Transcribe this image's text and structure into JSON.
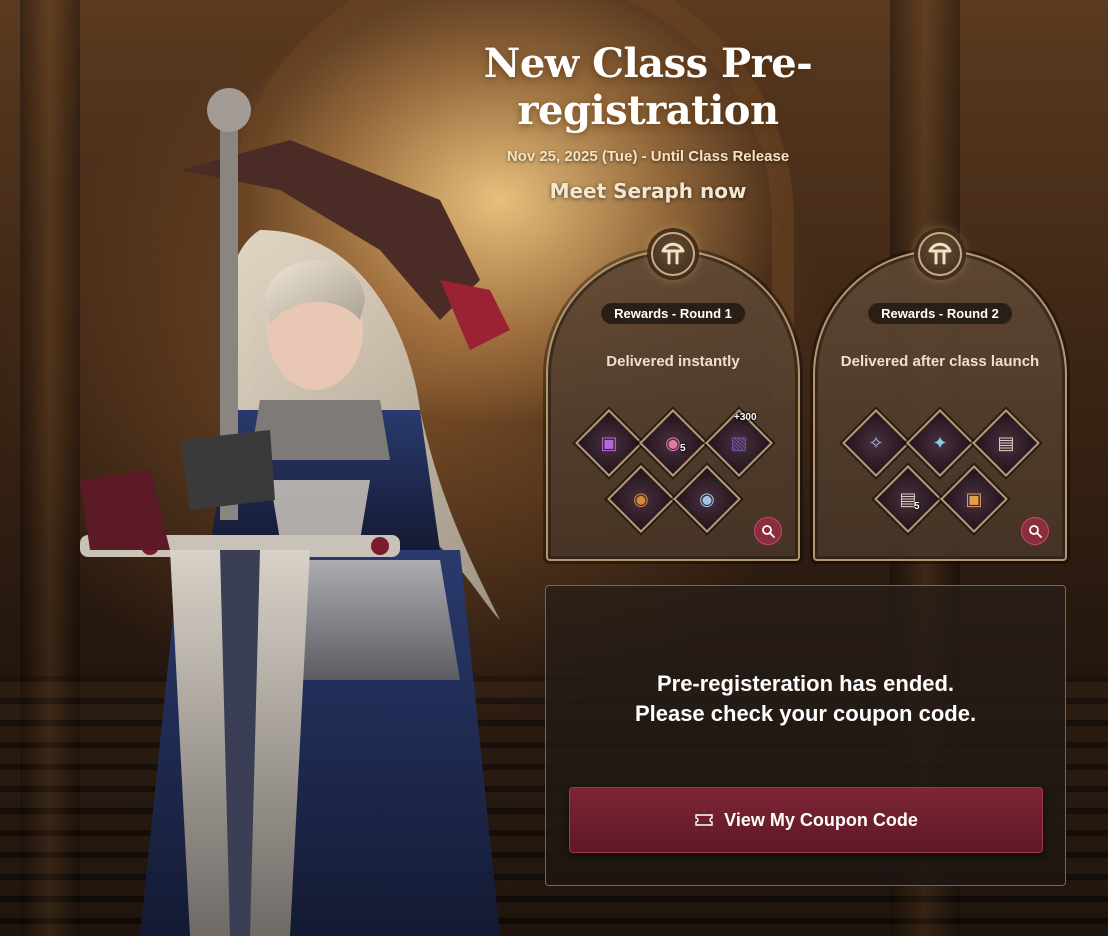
{
  "header": {
    "title": "New Class Pre-registration",
    "date_range": "Nov 25, 2025 (Tue) - Until Class Release",
    "subtitle": "Meet Seraph now"
  },
  "rewards": [
    {
      "round_label": "Rewards - Round 1",
      "delivery_text": "Delivered instantly",
      "items": [
        {
          "icon": "treasure-chest-icon",
          "count": ""
        },
        {
          "icon": "elixir-bottle-icon",
          "count": "5"
        },
        {
          "icon": "crate-icon",
          "count": "+300"
        },
        {
          "icon": "potion-flask-icon",
          "count": ""
        },
        {
          "icon": "vase-icon",
          "count": ""
        }
      ]
    },
    {
      "round_label": "Rewards - Round 2",
      "delivery_text": "Delivered after class launch",
      "items": [
        {
          "icon": "feather-quill-icon",
          "count": ""
        },
        {
          "icon": "wing-icon",
          "count": ""
        },
        {
          "icon": "scroll-icon",
          "count": ""
        },
        {
          "icon": "coupon-scroll-icon",
          "count": "5"
        },
        {
          "icon": "chest-icon",
          "count": ""
        }
      ]
    }
  ],
  "status_panel": {
    "line1": "Pre-registeration has ended.",
    "line2": "Please check your coupon code.",
    "button_label": "View My Coupon Code",
    "button_icon": "ticket-icon"
  },
  "colors": {
    "accent_button": "#7d2535",
    "card_border": "#b49570",
    "zoom_button": "#8a2d3c"
  }
}
